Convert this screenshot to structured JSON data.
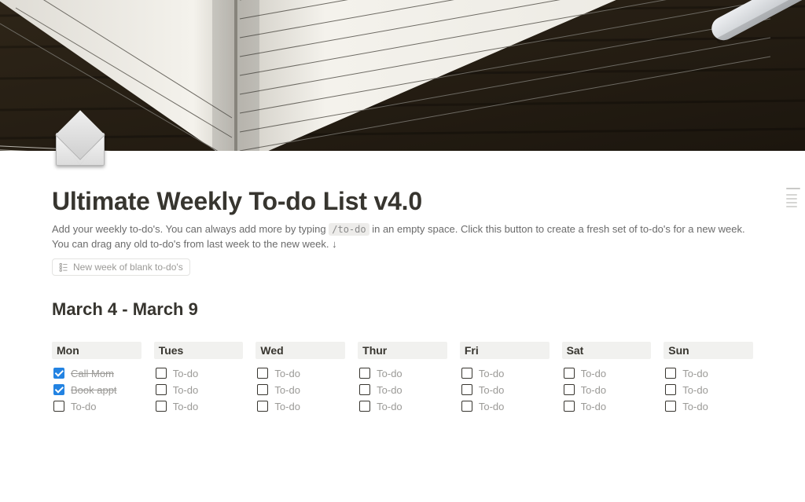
{
  "page_icon": "envelope-icon",
  "title": "Ultimate Weekly To-do List v4.0",
  "description": {
    "part1": "Add your weekly to-do's. You can always add more by typing ",
    "code": "/to-do",
    "part2": " in an empty space. Click this button to create a fresh set of to-do's for a new week. You can drag any old to-do's from last week to the new week. ↓"
  },
  "new_week_button": "New week of blank to-do's",
  "week_range": "March 4 - March 9",
  "days": [
    {
      "name": "Mon",
      "items": [
        {
          "label": "Call Mom",
          "checked": true
        },
        {
          "label": "Book appt",
          "checked": true
        },
        {
          "label": "To-do",
          "checked": false,
          "placeholder": true
        }
      ]
    },
    {
      "name": "Tues",
      "items": [
        {
          "label": "To-do",
          "checked": false,
          "placeholder": true
        },
        {
          "label": "To-do",
          "checked": false,
          "placeholder": true
        },
        {
          "label": "To-do",
          "checked": false,
          "placeholder": true
        }
      ]
    },
    {
      "name": "Wed",
      "items": [
        {
          "label": "To-do",
          "checked": false,
          "placeholder": true
        },
        {
          "label": "To-do",
          "checked": false,
          "placeholder": true
        },
        {
          "label": "To-do",
          "checked": false,
          "placeholder": true
        }
      ]
    },
    {
      "name": "Thur",
      "items": [
        {
          "label": "To-do",
          "checked": false,
          "placeholder": true
        },
        {
          "label": "To-do",
          "checked": false,
          "placeholder": true
        },
        {
          "label": "To-do",
          "checked": false,
          "placeholder": true
        }
      ]
    },
    {
      "name": "Fri",
      "items": [
        {
          "label": "To-do",
          "checked": false,
          "placeholder": true
        },
        {
          "label": "To-do",
          "checked": false,
          "placeholder": true
        },
        {
          "label": "To-do",
          "checked": false,
          "placeholder": true
        }
      ]
    },
    {
      "name": "Sat",
      "items": [
        {
          "label": "To-do",
          "checked": false,
          "placeholder": true
        },
        {
          "label": "To-do",
          "checked": false,
          "placeholder": true
        },
        {
          "label": "To-do",
          "checked": false,
          "placeholder": true
        }
      ]
    },
    {
      "name": "Sun",
      "items": [
        {
          "label": "To-do",
          "checked": false,
          "placeholder": true
        },
        {
          "label": "To-do",
          "checked": false,
          "placeholder": true
        },
        {
          "label": "To-do",
          "checked": false,
          "placeholder": true
        }
      ]
    }
  ]
}
